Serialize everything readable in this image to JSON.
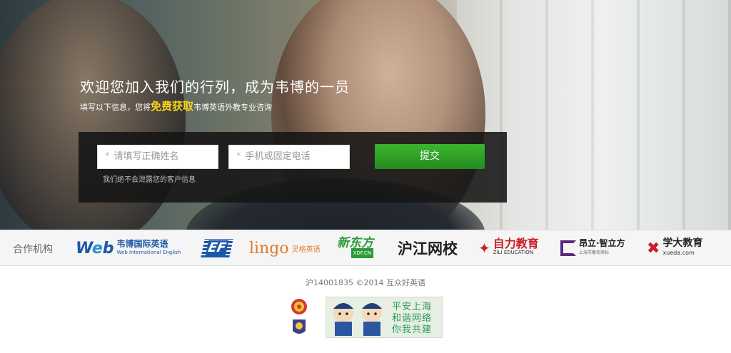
{
  "hero": {
    "headline": "欢迎您加入我们的行列，成为韦博的一员",
    "sub_before": "填写以下信息，您将",
    "sub_highlight": "免费获取",
    "sub_after": "韦博英语外教专业咨询"
  },
  "form": {
    "required_mark": "*",
    "name_placeholder": "请填写正确姓名",
    "phone_placeholder": "手机或固定电话",
    "submit_label": "提交",
    "privacy_note": "我们绝不会泄露您的客户信息"
  },
  "partners": {
    "label": "合作机构",
    "items": [
      {
        "name": "韦博国际英语",
        "sub": "Web International English",
        "mark": "Web",
        "color": "#1c57a8"
      },
      {
        "name": "EF",
        "sub": "",
        "mark": "EF",
        "color": "#1c57a8"
      },
      {
        "name": "lingo",
        "sub": "灵格英语",
        "mark": "lingo",
        "color": "#e07c2a"
      },
      {
        "name": "新东方",
        "sub": "XDF.CN",
        "mark": "新东方",
        "color": "#2b9a3a"
      },
      {
        "name": "沪江网校",
        "sub": "",
        "mark": "沪江网校",
        "color": "#222222"
      },
      {
        "name": "自力教育",
        "sub": "ZILI EDUCATION",
        "mark": "自力教育",
        "color": "#c81e25"
      },
      {
        "name": "昂立·智立方",
        "sub": "上海市著名商标",
        "mark": "昂立·智立方",
        "color": "#5a2b7d"
      },
      {
        "name": "学大教育",
        "sub": "xueda.com",
        "mark": "学大教育",
        "color": "#c81e25"
      }
    ]
  },
  "footer": {
    "copyright": "沪14001835 ©2014 互众好英语",
    "badge_lines": [
      "平安上海",
      "和谐网络",
      "你我共建"
    ]
  },
  "colors": {
    "accent_green": "#2fa628",
    "highlight_yellow": "#f6d21c"
  }
}
